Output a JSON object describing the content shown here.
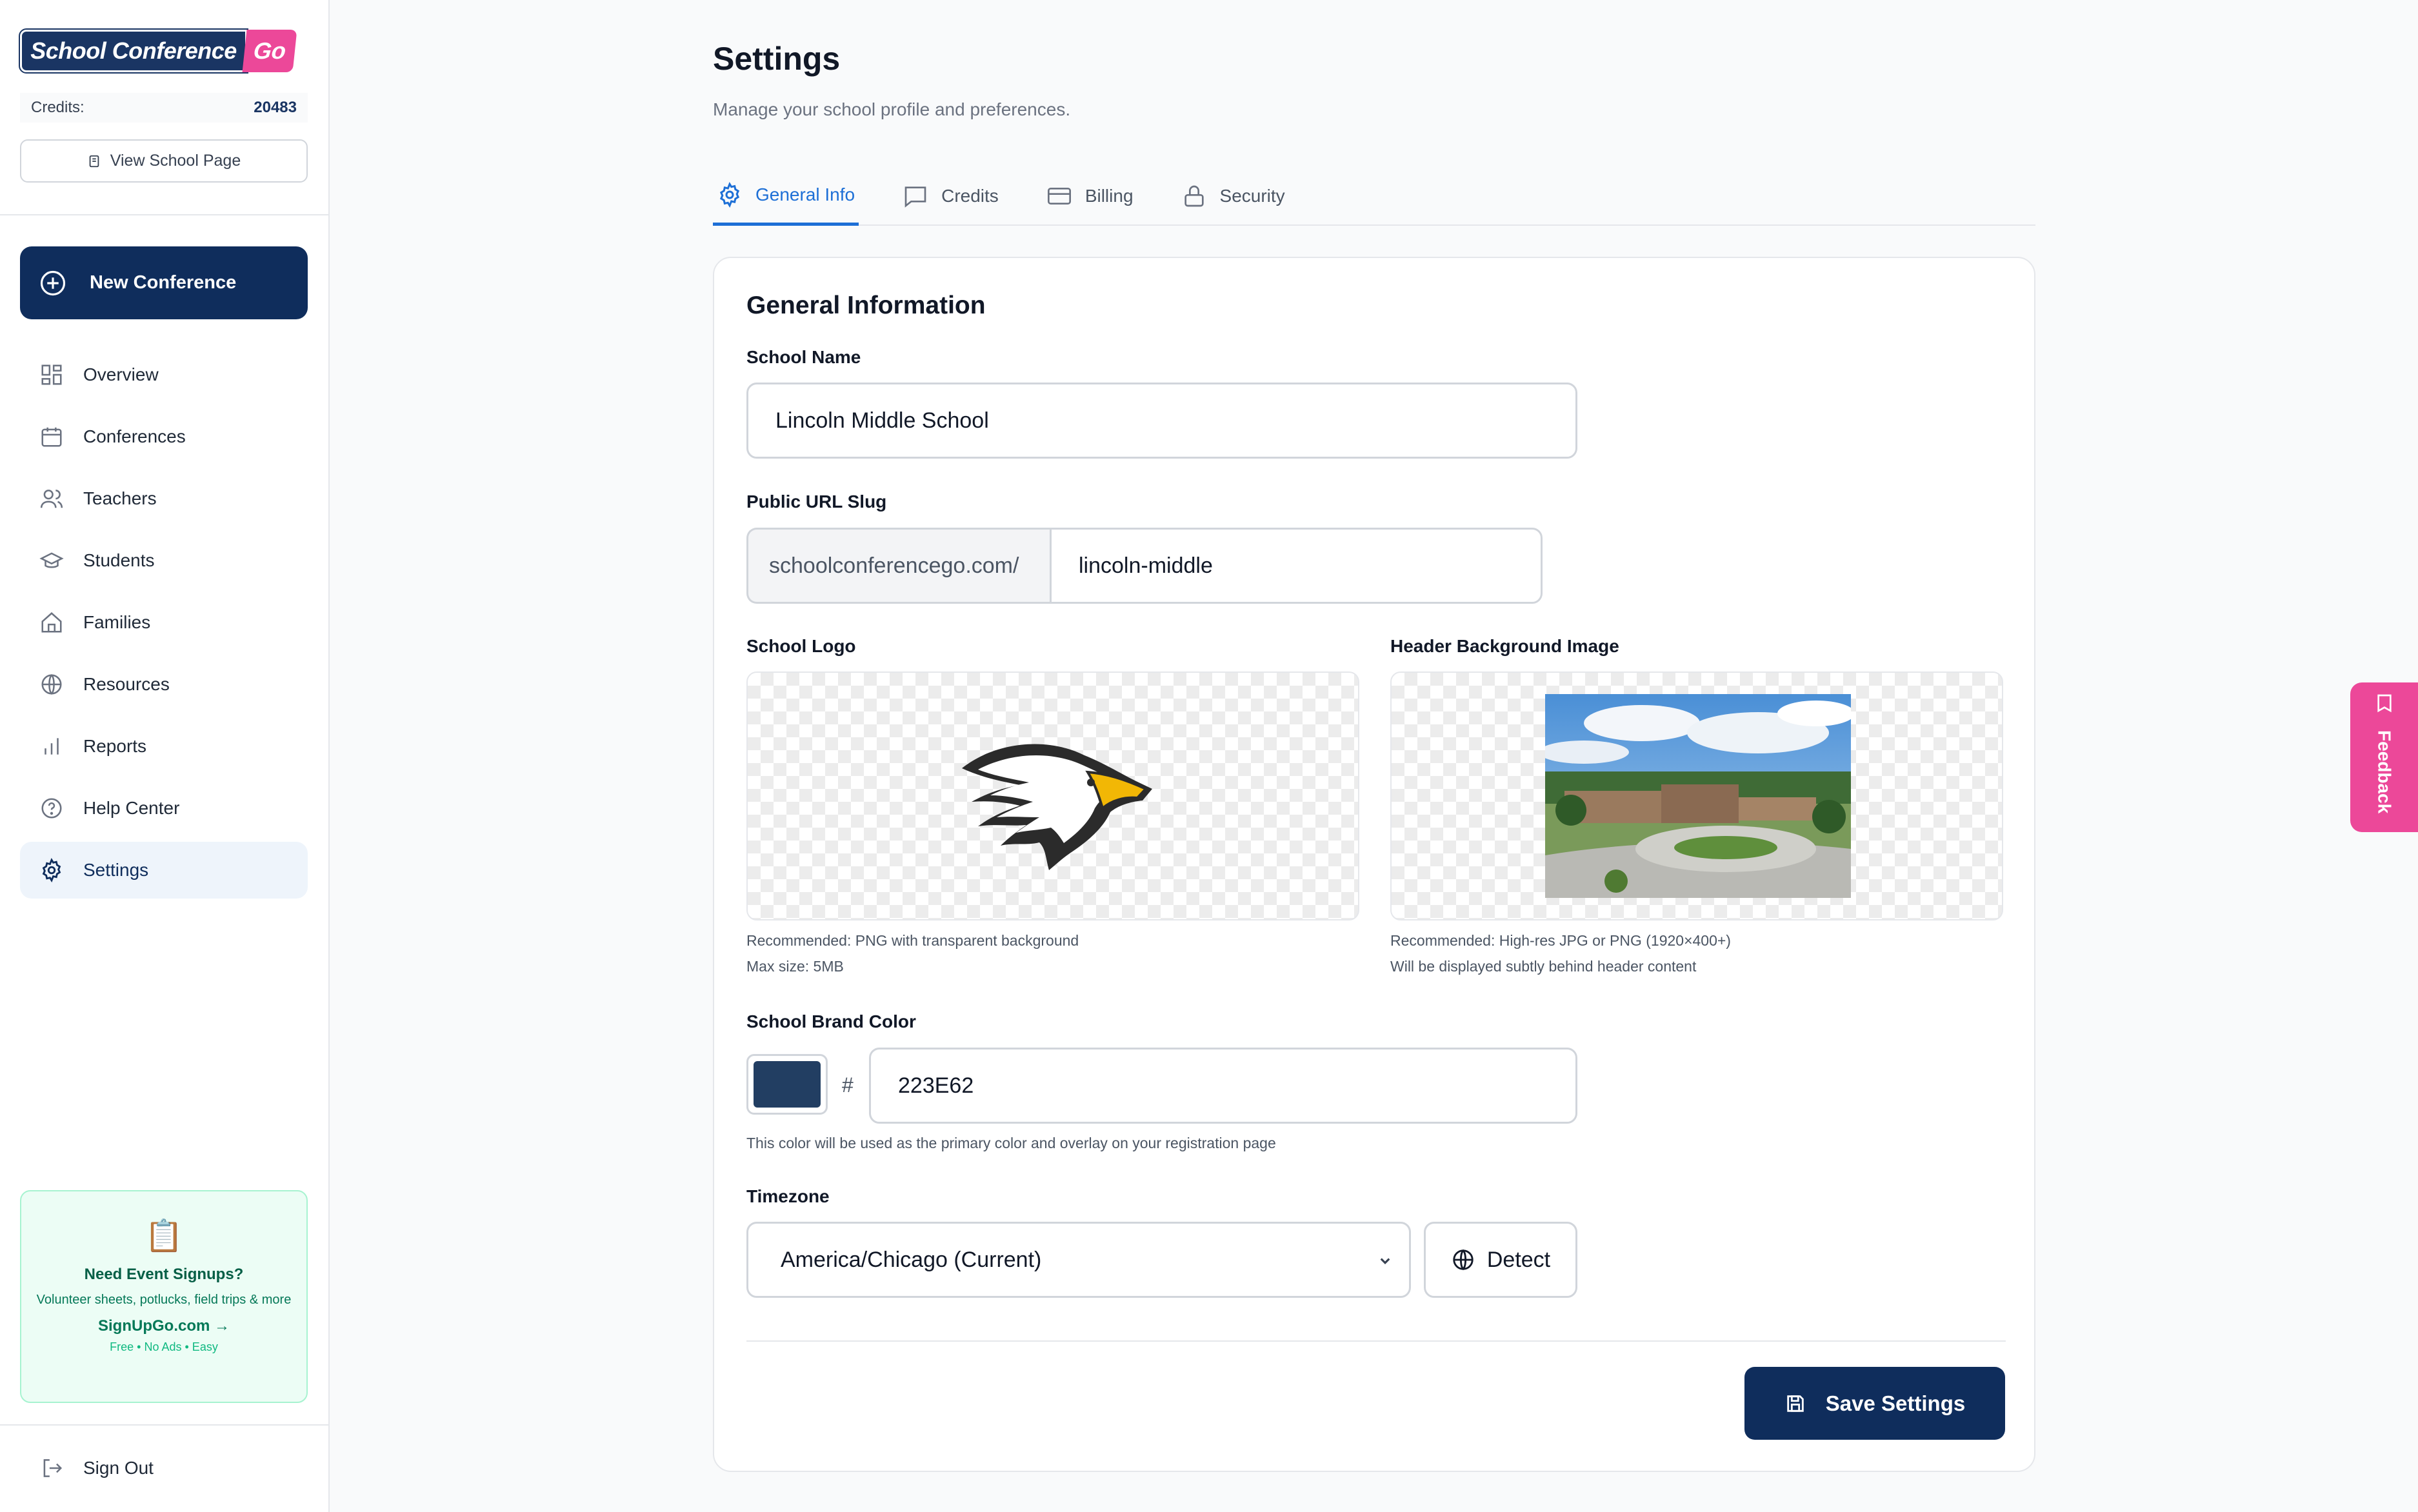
{
  "brand": {
    "name_main": "School Conference",
    "name_go": "Go"
  },
  "sidebar": {
    "credits_label": "Credits:",
    "credits_value": "20483",
    "view_school_page": "View School Page",
    "new_conference": "New Conference",
    "items": [
      {
        "label": "Overview",
        "icon": "grid-icon"
      },
      {
        "label": "Conferences",
        "icon": "calendar-icon"
      },
      {
        "label": "Teachers",
        "icon": "users-icon"
      },
      {
        "label": "Students",
        "icon": "graduation-cap-icon"
      },
      {
        "label": "Families",
        "icon": "home-icon"
      },
      {
        "label": "Resources",
        "icon": "globe-icon"
      },
      {
        "label": "Reports",
        "icon": "bar-chart-icon"
      },
      {
        "label": "Help Center",
        "icon": "help-circle-icon"
      },
      {
        "label": "Settings",
        "icon": "gear-icon",
        "active": true
      }
    ],
    "promo": {
      "title": "Need Event Signups?",
      "description": "Volunteer sheets, potlucks, field trips & more",
      "link": "SignUpGo.com →",
      "footer": "Free • No Ads • Easy"
    },
    "sign_out": "Sign Out"
  },
  "page": {
    "title": "Settings",
    "subtitle": "Manage your school profile and preferences.",
    "tabs": [
      {
        "label": "General Info",
        "icon": "gear-icon",
        "active": true
      },
      {
        "label": "Credits",
        "icon": "message-square-icon"
      },
      {
        "label": "Billing",
        "icon": "credit-card-icon"
      },
      {
        "label": "Security",
        "icon": "lock-icon"
      }
    ]
  },
  "form": {
    "section_title": "General Information",
    "school_name_label": "School Name",
    "school_name_value": "Lincoln Middle School",
    "slug_label": "Public URL Slug",
    "slug_prefix": "schoolconferencego.com/",
    "slug_value": "lincoln-middle",
    "logo_label": "School Logo",
    "logo_hint_1": "Recommended: PNG with transparent background",
    "logo_hint_2": "Max size: 5MB",
    "header_bg_label": "Header Background Image",
    "header_hint_1": "Recommended: High-res JPG or PNG (1920×400+)",
    "header_hint_2": "Will be displayed subtly behind header content",
    "brand_color_label": "School Brand Color",
    "brand_color_hash": "#",
    "brand_color_value": "223E62",
    "brand_color_hint": "This color will be used as the primary color and overlay on your registration page",
    "timezone_label": "Timezone",
    "timezone_value": "America/Chicago (Current)",
    "detect_label": "Detect",
    "save_label": "Save Settings"
  },
  "feedback_label": "Feedback",
  "colors": {
    "brand": "#223E62",
    "primary_button": "#0f2d5c",
    "accent": "#1d6fd6",
    "feedback": "#ec4899"
  }
}
